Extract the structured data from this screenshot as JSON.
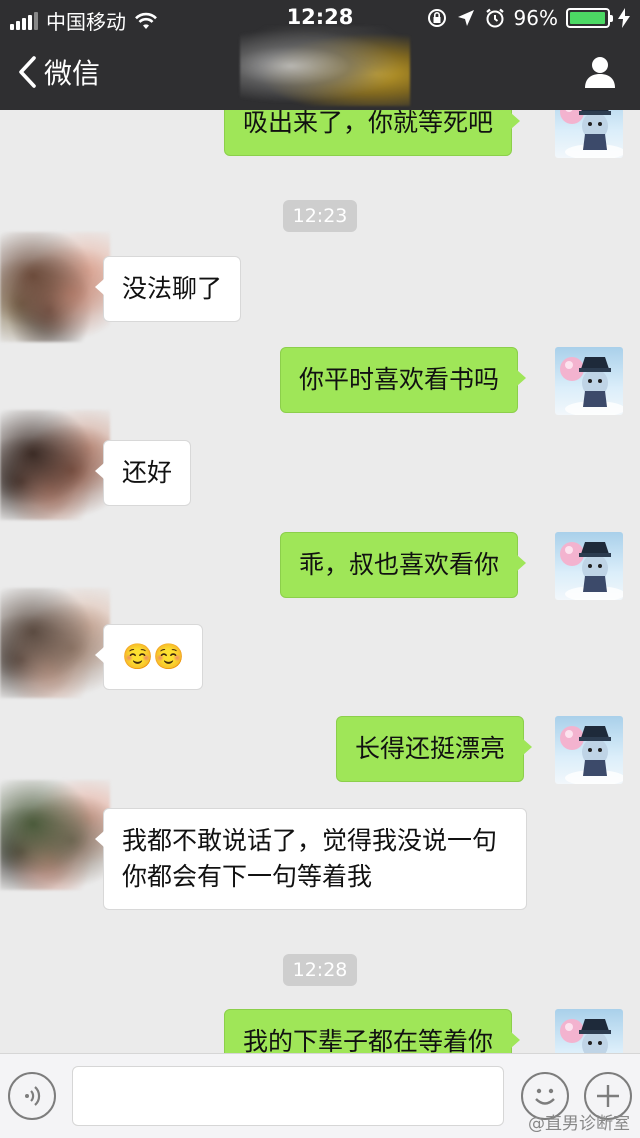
{
  "status_bar": {
    "carrier": "中国移动",
    "time": "12:28",
    "battery_percent": "96%",
    "battery_level": 0.96,
    "battery_color": "#4cd964",
    "icons": [
      "signal-icon",
      "wifi-icon",
      "screen-lock-icon",
      "location-icon",
      "alarm-icon",
      "battery-icon",
      "charging-icon"
    ]
  },
  "nav": {
    "back_label": "微信",
    "icons": [
      "chevron-left-icon",
      "contact-profile-icon"
    ]
  },
  "messages": [
    {
      "side": "out",
      "text": "吸出来了，你就等死吧"
    },
    {
      "type": "time",
      "text": "12:23"
    },
    {
      "side": "in",
      "text": "没法聊了"
    },
    {
      "side": "out",
      "text": "你平时喜欢看书吗"
    },
    {
      "side": "in",
      "text": "还好"
    },
    {
      "side": "out",
      "text": "乖，叔也喜欢看你"
    },
    {
      "side": "in",
      "text": "☺️☺️"
    },
    {
      "side": "out",
      "text": "长得还挺漂亮"
    },
    {
      "side": "in",
      "text": "我都不敢说话了，觉得我没说一句你都会有下一句等着我"
    },
    {
      "type": "time",
      "text": "12:28"
    },
    {
      "side": "out",
      "text": "我的下辈子都在等着你"
    }
  ],
  "input_bar": {
    "placeholder": "",
    "icons": [
      "voice-icon",
      "emoji-icon",
      "plus-icon"
    ]
  },
  "watermark": "@直男诊断室",
  "colors": {
    "header_bg": "#2f2f31",
    "chat_bg": "#ebebeb",
    "outgoing_bubble": "#9fe658",
    "incoming_bubble": "#ffffff"
  }
}
